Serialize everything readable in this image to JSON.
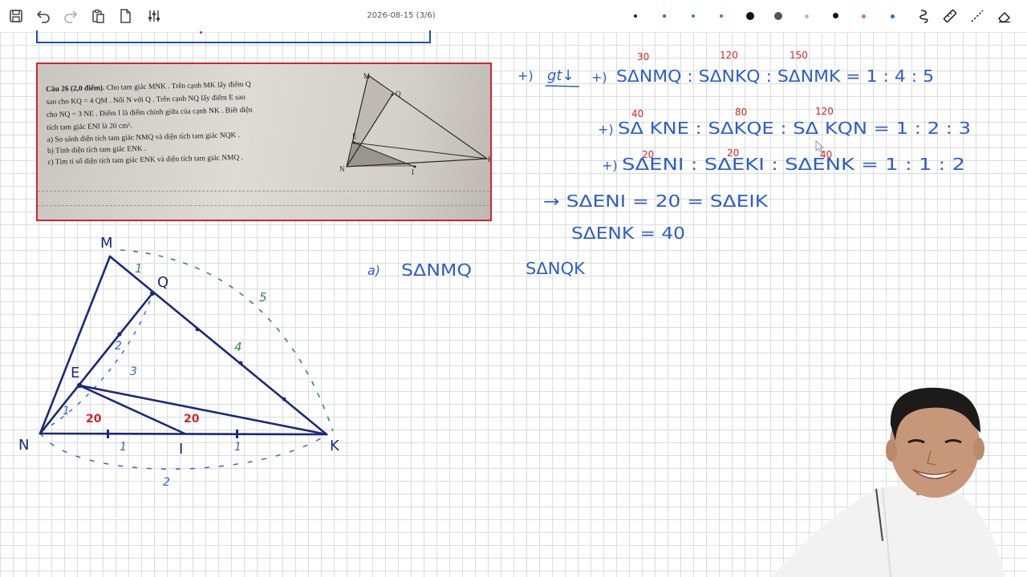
{
  "toolbar": {
    "page_indicator": "2026-08-15 (3/6)",
    "buttons": [
      "save-icon",
      "undo-icon",
      "redo-icon",
      "paste-icon",
      "new-page-icon",
      "settings-sliders-icon"
    ],
    "tools": [
      "lasso-icon",
      "ruler-icon",
      "pen-icon",
      "eraser-icon"
    ],
    "pen_swatches": [
      "#222222",
      "#c0392b",
      "#1e8bc3",
      "#2b7fd6",
      "#111111",
      "#555555",
      "#bbbbbb",
      "#111111",
      "#e05ad8",
      "#1e6fd6"
    ]
  },
  "problem": {
    "line1_bold": "Câu 26 (2,0 điểm).",
    "line1": " Cho tam giác MNK . Trên cạnh MK lấy điểm Q",
    "line2": "sao cho KQ = 4 QM . Nối N với Q . Trên cạnh NQ lấy điểm E sao",
    "line3": "cho NQ = 3 NE . Điểm I là điểm chính giữa của cạnh NK . Biết diện",
    "line4": "tích tam giác ENI là 20 cm².",
    "line5": "a) So sánh diện tích tam giác NMQ và diện tích tam giác NQK .",
    "line6": "b) Tính diện tích tam giác ENK .",
    "line7": "c) Tìm tỉ số diện tích tam giác ENK và diện tích tam giác NMQ .",
    "figure_labels": {
      "M": "M",
      "Q": "Q",
      "E": "E",
      "N": "N",
      "I": "I",
      "K": "K"
    }
  },
  "drawing": {
    "labels": {
      "M": "M",
      "Q": "Q",
      "E": "E",
      "N": "N",
      "I": "I",
      "K": "K"
    },
    "green_marks": {
      "mq": "1",
      "qk": "4",
      "mk": "5"
    },
    "blue_marks": {
      "ne": "1",
      "eq": "2",
      "nq": "3",
      "ni": "1",
      "ik": "1",
      "nk": "2"
    },
    "red_areas": {
      "eni": "20",
      "eik": "20"
    }
  },
  "notes": {
    "line1": {
      "prefix": "+)",
      "gt": "gt↓",
      "arrow": "+)",
      "text": "SΔNMQ : SΔNKQ : SΔNMK = 1 : 4 : 5",
      "red": [
        "30",
        "120",
        "150"
      ]
    },
    "line2": {
      "prefix": "+)",
      "text": "SΔ KNE : SΔKQE : SΔ KQN = 1 : 2 : 3",
      "red": [
        "40",
        "80",
        "120"
      ]
    },
    "line3": {
      "prefix": "+)",
      "text": "SΔENI : SΔEKI : SΔENK = 1 : 1 : 2",
      "red": [
        "20",
        "20",
        "40"
      ]
    },
    "line4": {
      "text": "→ SΔENI = 20 = SΔEIK"
    },
    "line5": {
      "text": "SΔENK = 40"
    },
    "part_a": {
      "label": "a)",
      "left": "SΔNMQ",
      "right": "SΔNQK"
    }
  }
}
